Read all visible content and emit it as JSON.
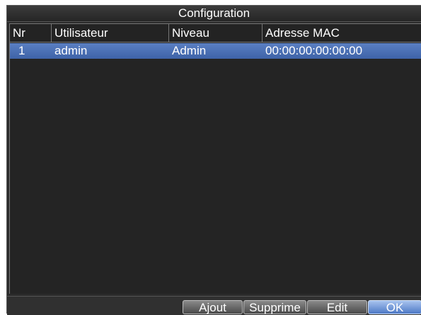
{
  "window": {
    "title": "Configuration"
  },
  "table": {
    "headers": [
      "Nr",
      "Utilisateur",
      "Niveau",
      "Adresse MAC"
    ],
    "rows": [
      {
        "nr": "1",
        "user": "admin",
        "level": "Admin",
        "mac": "00:00:00:00:00:00"
      }
    ]
  },
  "buttons": {
    "add": "Ajout",
    "delete": "Supprime",
    "edit": "Edit",
    "ok": "OK"
  },
  "colors": {
    "selected_row": "#4a6fb5",
    "background": "#2b2b2b",
    "active_button": "#6f98d9"
  }
}
